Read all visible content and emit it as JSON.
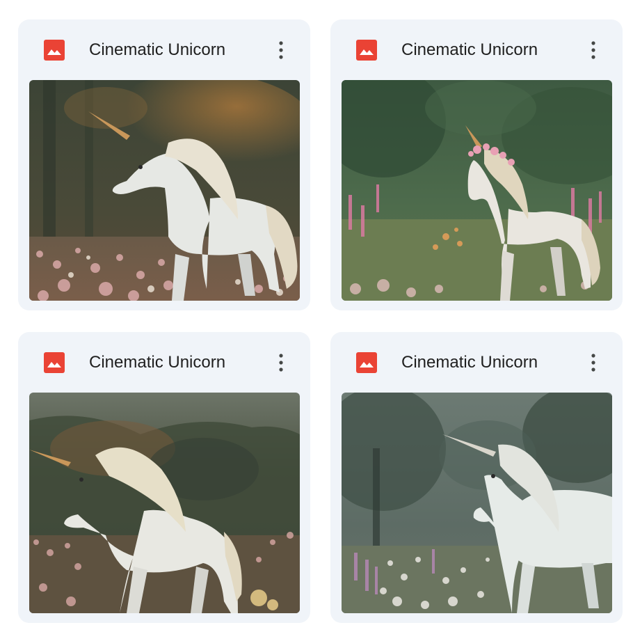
{
  "files": [
    {
      "title": "Cinematic Unicorn",
      "icon": "image-file-icon",
      "menu_icon": "more-vert-icon",
      "scene": "autumn-forest-meadow"
    },
    {
      "title": "Cinematic Unicorn",
      "icon": "image-file-icon",
      "menu_icon": "more-vert-icon",
      "scene": "green-forest-flower-crown"
    },
    {
      "title": "Cinematic Unicorn",
      "icon": "image-file-icon",
      "menu_icon": "more-vert-icon",
      "scene": "misty-hills-meadow"
    },
    {
      "title": "Cinematic Unicorn",
      "icon": "image-file-icon",
      "menu_icon": "more-vert-icon",
      "scene": "foggy-grey-forest"
    }
  ],
  "colors": {
    "card_bg": "#f0f4f9",
    "icon_red": "#ea4335",
    "title_text": "#1f1f1f",
    "menu_icon": "#444746"
  }
}
